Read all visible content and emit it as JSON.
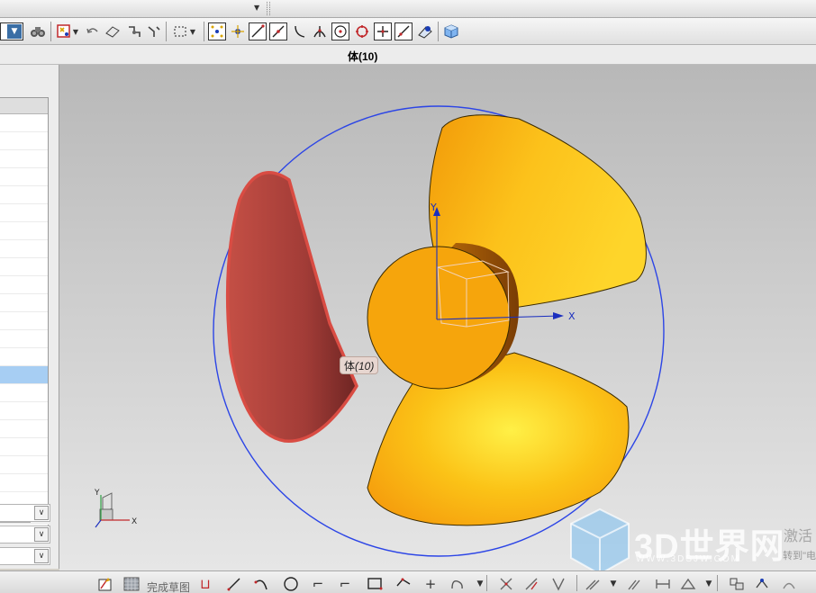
{
  "window": {
    "status_label": "体(10)"
  },
  "topbar": {
    "dropdown_icon": "dropdown-arrow-icon"
  },
  "toolbar": {
    "icons": [
      "selection-filter-dropdown-icon",
      "binoculars-icon",
      "filter-select-icon",
      "eraser-icon",
      "undo-selection-icon",
      "snap-point-icon",
      "snap-icon",
      "rectangle-select-icon",
      "end-point-icon",
      "mid-point-icon",
      "line-point-icon",
      "curve-point-icon",
      "intersection-icon",
      "center-point-icon",
      "quadrant-icon",
      "existing-point-icon",
      "point-on-curve-icon",
      "point-on-face-icon",
      "cube-icon"
    ]
  },
  "navigator": {
    "selected_row": 15
  },
  "viewport": {
    "tooltip_label": "体",
    "tooltip_number": "(10)",
    "triad_x": "X",
    "triad_y": "Y",
    "csys_x": "X",
    "csys_y": "Y",
    "watermark_logo": "3D世界网",
    "watermark_url": "WWW.3DSJW.COM",
    "activate_text": "激活",
    "activate_sub": "转到\"电"
  },
  "bottombar": {
    "finish_sketch_label": "完成草图",
    "icons": [
      "finish-sketch-icon",
      "sketch-grid-icon",
      "profile-icon",
      "line-icon",
      "arc-icon",
      "circle-icon",
      "fillet-icon",
      "chamfer-icon",
      "rectangle-icon",
      "polygon-icon",
      "point-icon",
      "studio-spline-icon",
      "trim-icon",
      "extend-icon",
      "corner-icon",
      "offset-icon",
      "constraint-icon",
      "dimension-icon",
      "display-icon"
    ]
  },
  "colors": {
    "blade_selected": "#b94a42",
    "blade_yellow": "#f9b514",
    "hub": "#f6a50c",
    "circle": "#2c45e6",
    "selection_row": "#a7cef3"
  }
}
